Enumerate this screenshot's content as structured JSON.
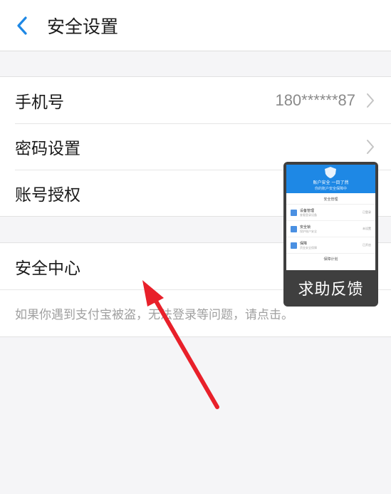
{
  "header": {
    "title": "安全设置"
  },
  "group1": {
    "phone": {
      "label": "手机号",
      "value": "180******87"
    },
    "password": {
      "label": "密码设置"
    },
    "auth": {
      "label": "账号授权"
    }
  },
  "group2": {
    "security_center": {
      "label": "安全中心"
    },
    "tip": "如果你遇到支付宝被盗，无法登录等问题，请点击。"
  },
  "feedback": {
    "label": "求助反馈",
    "preview": {
      "banner_line1": "账户安全 一目了然",
      "banner_line2": "你的账户安全保障中",
      "section": "安全管理",
      "items": [
        {
          "name": "设备管理",
          "desc": "查看登录设备",
          "status": "已登录"
        },
        {
          "name": "安全锁",
          "desc": "保护账户安全",
          "status": "未设置"
        },
        {
          "name": "保障",
          "desc": "资金安全保障",
          "status": "已开启"
        }
      ],
      "footer": "保障计划"
    }
  },
  "colors": {
    "accent": "#1e88e5",
    "arrow": "#e8202a"
  }
}
